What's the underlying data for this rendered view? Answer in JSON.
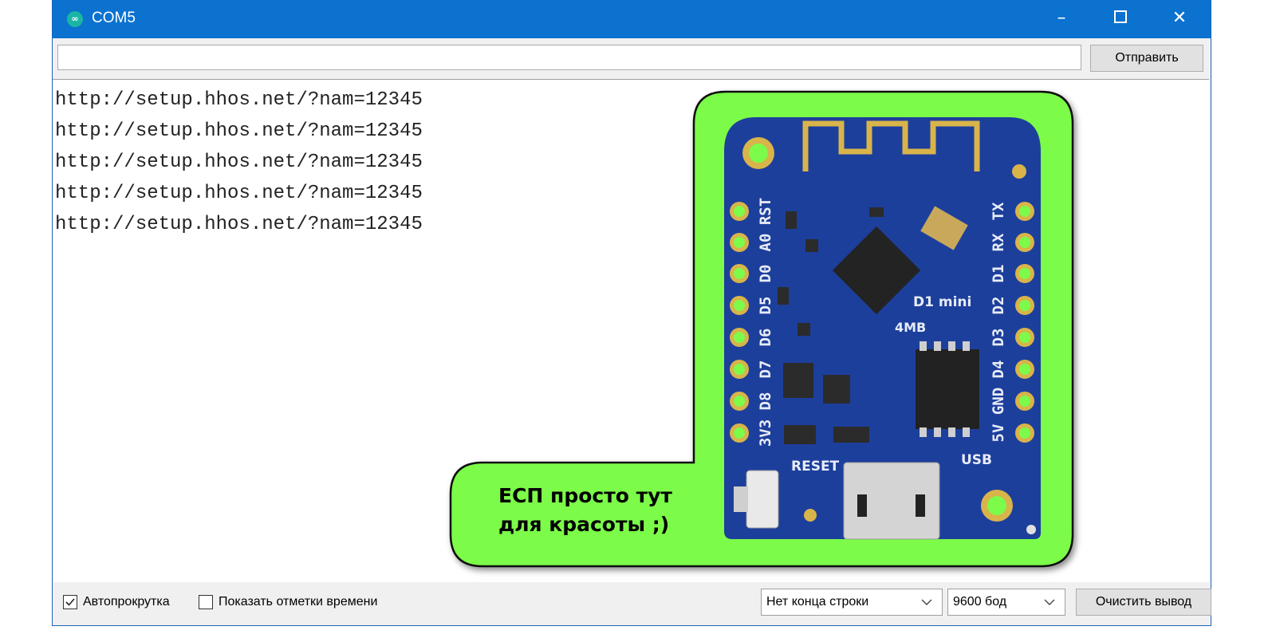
{
  "window": {
    "title": "COM5",
    "app_icon": "arduino-infinity-icon"
  },
  "titlebar_buttons": {
    "minimize": "–",
    "close": "✕"
  },
  "send": {
    "input_value": "",
    "button_label": "Отправить"
  },
  "output": {
    "lines": [
      "http://setup.hhos.net/?nam=12345",
      "http://setup.hhos.net/?nam=12345",
      "http://setup.hhos.net/?nam=12345",
      "http://setup.hhos.net/?nam=12345",
      "http://setup.hhos.net/?nam=12345"
    ]
  },
  "bottom": {
    "autoscroll": {
      "label": "Автопрокрутка",
      "checked": true
    },
    "timestamps": {
      "label": "Показать отметки времени",
      "checked": false
    },
    "line_ending": {
      "value": "Нет конца строки"
    },
    "baud": {
      "value": "9600 бод"
    },
    "clear_label": "Очистить вывод"
  },
  "overlay": {
    "caption_line1": "ЕСП просто тут",
    "caption_line2": "для красоты ;)",
    "board": {
      "left_pins": [
        "RST",
        "A0",
        "D0",
        "D5",
        "D6",
        "D7",
        "D8",
        "3V3"
      ],
      "right_pins": [
        "TX",
        "RX",
        "D1",
        "D2",
        "D3",
        "D4",
        "GND",
        "5V"
      ],
      "model_label": "D1 mini",
      "flash_label": "4MB",
      "reset_label": "RESET",
      "usb_label": "USB"
    },
    "colors": {
      "bubble_green": "#7cfb4a",
      "board_blue": "#1d3f9c",
      "gold": "#d8b44a"
    }
  }
}
